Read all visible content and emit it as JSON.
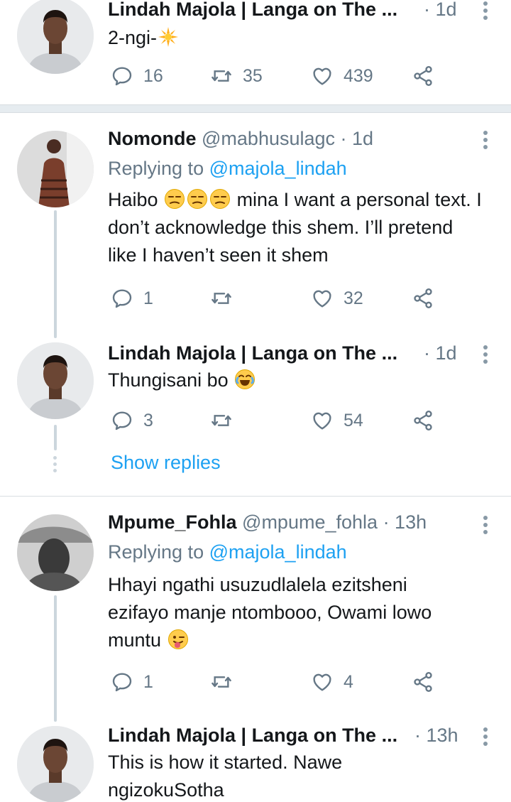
{
  "colors": {
    "accent": "#1da1f2",
    "muted": "#657786",
    "text": "#14171a",
    "thread": "#ccd6dd"
  },
  "tweets": [
    {
      "name": "Lindah Majola | Langa on The ...",
      "handle": "",
      "time": "· 1d",
      "replying_label": "",
      "replying_to": "",
      "text": "2-ngi-",
      "emoji": [
        "sparkle"
      ],
      "replies": "16",
      "retweets": "35",
      "likes": "439"
    },
    {
      "name": "Nomonde",
      "handle": "@mabhusulagc",
      "time": "· 1d",
      "replying_label": "Replying to",
      "replying_to": "@majola_lindah",
      "text_a": "Haibo",
      "text_b": " mina I want a personal text. I don’t acknowledge this shem. I’ll pretend like I haven’t seen it shem",
      "emoji": [
        "unamused",
        "unamused",
        "unamused"
      ],
      "replies": "1",
      "retweets": "",
      "likes": "32"
    },
    {
      "name": "Lindah Majola | Langa on The ...",
      "handle": "",
      "time": "· 1d",
      "text": "Thungisani bo",
      "emoji": [
        "joy"
      ],
      "replies": "3",
      "retweets": "",
      "likes": "54",
      "show_replies": "Show replies"
    },
    {
      "name": "Mpume_Fohla",
      "handle": "@mpume_fohla",
      "time": "· 13h",
      "replying_label": "Replying to",
      "replying_to": "@majola_lindah",
      "text": "Hhayi ngathi usuzudlalela ezitsheni ezifayo manje ntombooo, Owami lowo muntu",
      "emoji": [
        "winking-tongue"
      ],
      "replies": "1",
      "retweets": "",
      "likes": "4"
    },
    {
      "name": "Lindah Majola | Langa on The ...",
      "handle": "",
      "time": "· 13h",
      "text": "This is how it started. Nawe ngizokuSotha",
      "emoji": []
    }
  ]
}
